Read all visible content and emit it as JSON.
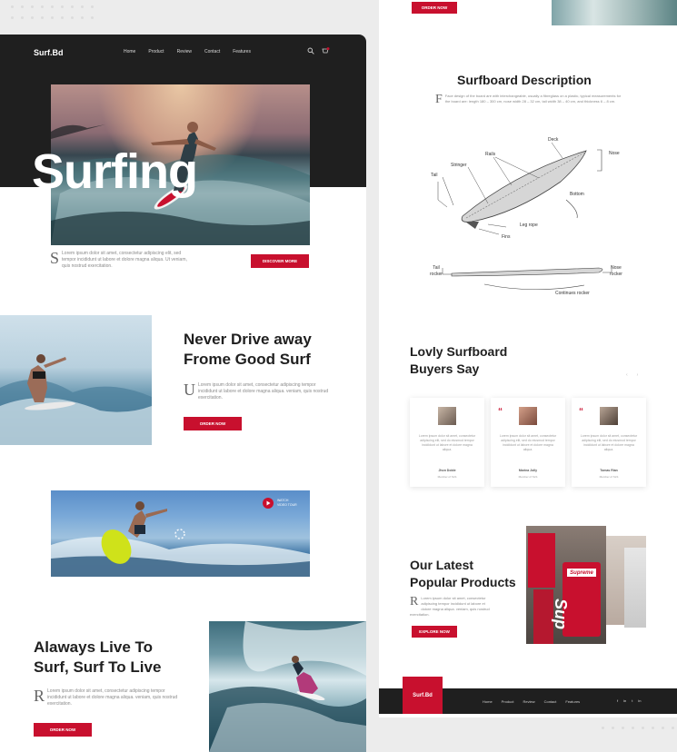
{
  "brand": "Surf.Bd",
  "nav": [
    "Home",
    "Product",
    "Review",
    "Contact",
    "Features"
  ],
  "hero": {
    "title": "Surfing",
    "caption": "Lorem ipsum dolor sit amet, consectetur adipiscing elit, sed tempor incididunt ut labore et dolore magna aliqua. Ut veniam, quis nostrud exercitation.",
    "button": "DISCOVER MORE"
  },
  "section_drive": {
    "heading_line1": "Never Drive away",
    "heading_line2": "Frome Good Surf",
    "caption": "Lorem ipsum dolor sit amet, consectetur adipiscing tempor incididunt ut labore et dolore magna aliqua. veniam, quis nostrud exercitation.",
    "button": "ORDER NOW"
  },
  "video": {
    "label_line1": "WATCH",
    "label_line2": "VIDEO TOUR"
  },
  "section_live": {
    "heading_line1": "Alaways Live To",
    "heading_line2": "Surf, Surf To Live",
    "caption": "Lorem ipsum dolor sit amet, consectetur adipiscing tempor incididunt ut labore et dolore magna aliqua. veniam, quis nostrud exercitation.",
    "button": "ORDER NOW"
  },
  "top_button": "ORDER NOW",
  "description": {
    "heading": "Surfboard Description",
    "text": "Face design of the board are with interchangeable, usually a fibreglass on a plastic, typical measurements for the board are: length 180 – 300 cm, nose width 28 – 32 cm, tail width 38 – 40 cm, and thickness 6 – 8 cm.",
    "labels": {
      "deck": "Deck",
      "rails": "Rails",
      "nose": "Nose",
      "stringer": "Stringer",
      "tail": "Tail",
      "bottom": "Bottom",
      "leg_rope": "Leg rope",
      "fins": "Fins",
      "tail_rocker_1": "Tail",
      "tail_rocker_2": "rocker",
      "nose_rocker_1": "Nose",
      "nose_rocker_2": "rocker",
      "continues_rocker": "Continues rocker"
    }
  },
  "reviews": {
    "heading_line1": "Lovly Surfboard",
    "heading_line2": "Buyers Say",
    "cards": [
      {
        "text": "Lorem ipsum dolor sit amet, consectetur adipiscing elit, sed do eiusmod tempor incididunt ut labore et dolore magna aliqua.",
        "name": "Jhon Doble",
        "role": "Member of SLS"
      },
      {
        "text": "Lorem ipsum dolor sit amet, consectetur adipiscing elit, sed do eiusmod tempor incididunt ut labore et dolore magna aliqua.",
        "name": "Marina Jolly",
        "role": "Member of SLS"
      },
      {
        "text": "Lorem ipsum dolor sit amet, consectetur adipiscing elit, sed do eiusmod tempor incididunt ut labore et dolore magna aliqua.",
        "name": "Tomas Rian",
        "role": "Member of SLS"
      }
    ]
  },
  "products": {
    "heading_line1": "Our Latest",
    "heading_line2": "Popular Products",
    "caption": "Lorem ipsum dolor sit amet, consectetur adipiscing tempor incididunt ut labore et dolore magna aliqua. veniam, quis nostrud exercitation.",
    "button": "EXPLORE NOW",
    "supreme_text": "Supreme",
    "supreme_bag_text": "Sup"
  },
  "footer": {
    "logo": "Surf.Bd",
    "nav": [
      "Home",
      "Product",
      "Review",
      "Contact",
      "Features"
    ],
    "social": [
      "f",
      "in",
      "t",
      "in"
    ]
  },
  "colors": {
    "accent": "#c8102e",
    "dark": "#1f1f1f"
  }
}
